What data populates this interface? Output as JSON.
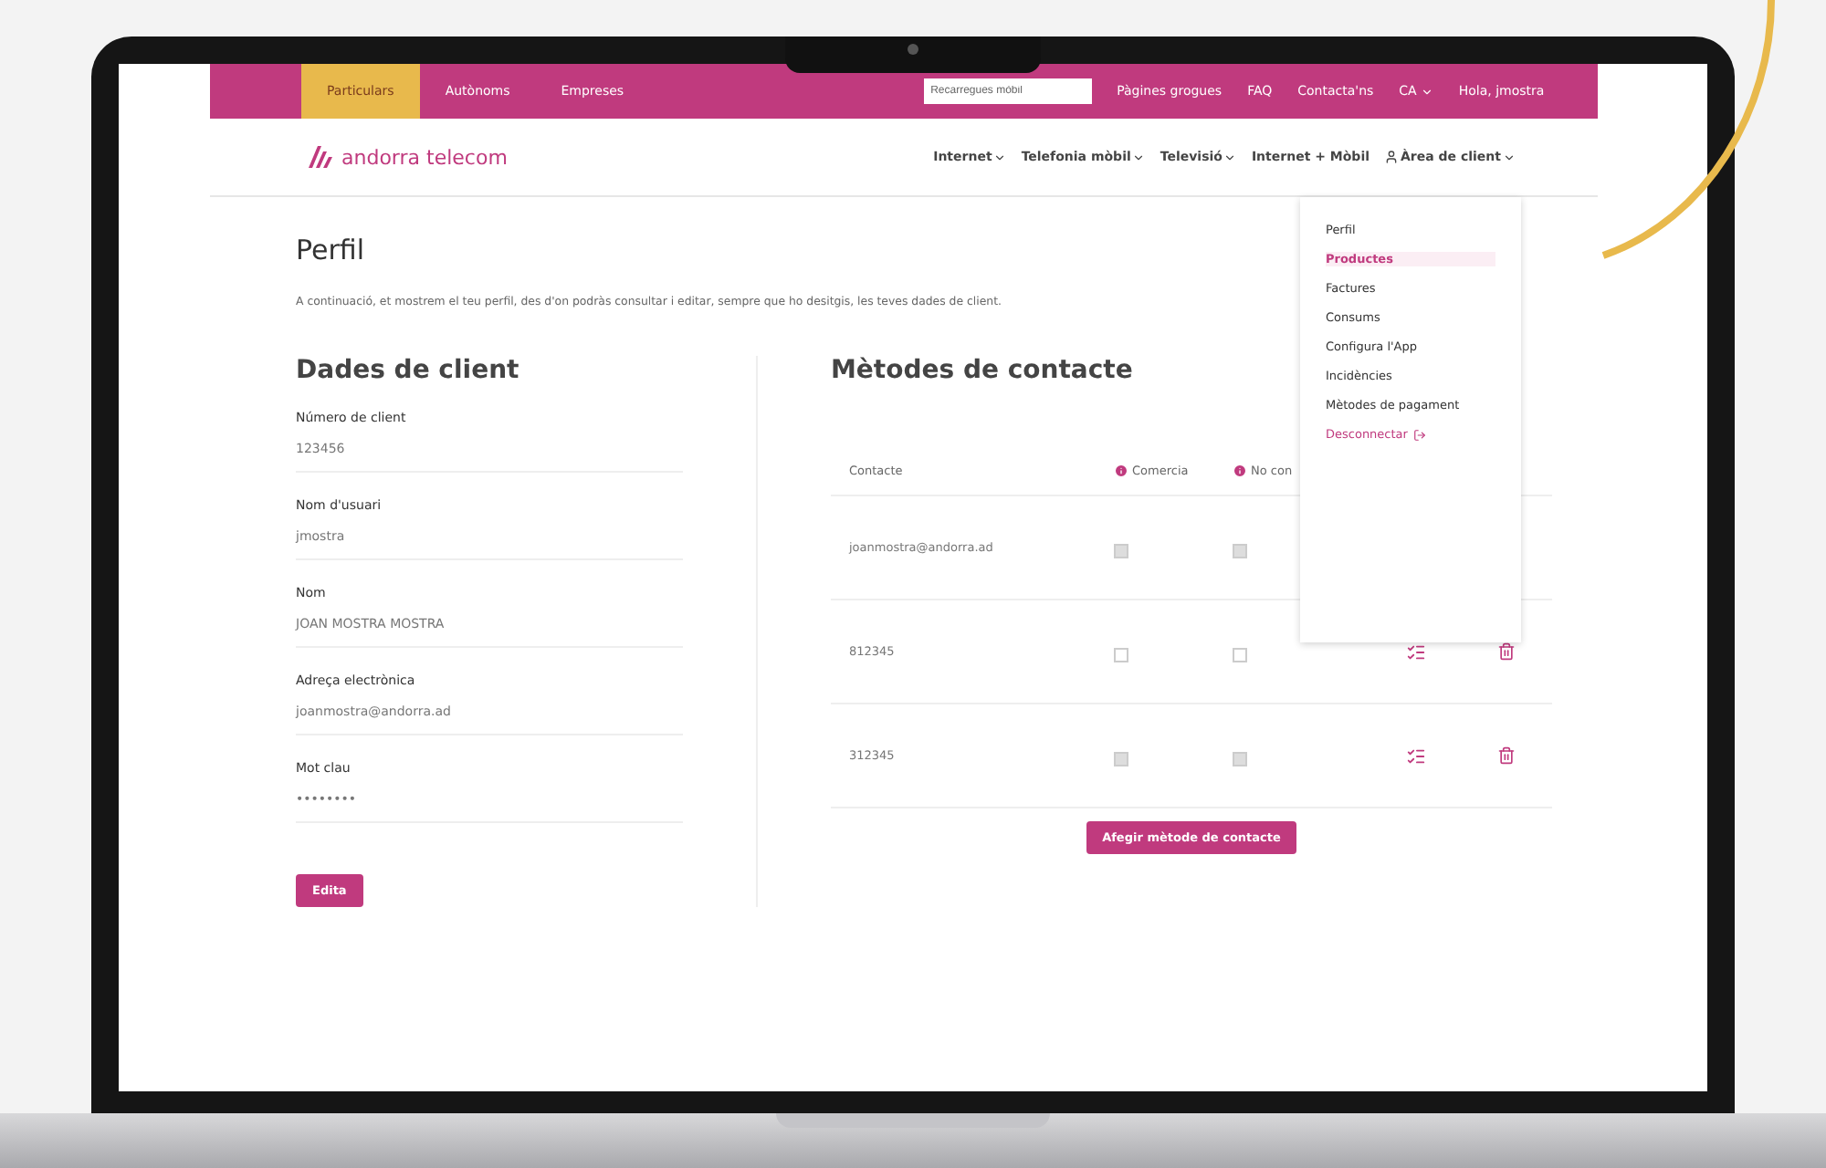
{
  "topbar": {
    "tabs": [
      {
        "label": "Particulars",
        "selected": true
      },
      {
        "label": "Autònoms",
        "selected": false
      },
      {
        "label": "Empreses",
        "selected": false
      }
    ],
    "search": {
      "placeholder": "Recarregues mòbil"
    },
    "links": [
      "Pàgines grogues",
      "FAQ",
      "Contacta'ns"
    ],
    "language": "CA",
    "greeting": "Hola, jmostra"
  },
  "brand": "andorra telecom",
  "nav": [
    {
      "label": "Internet",
      "kind": "menu"
    },
    {
      "label": "Telefonia mòbil",
      "kind": "menu"
    },
    {
      "label": "Televisió",
      "kind": "menu"
    },
    {
      "label": "Internet + Mòbil",
      "kind": "link"
    },
    {
      "label": "Àrea de client",
      "kind": "account"
    }
  ],
  "user_menu": {
    "items": [
      {
        "label": "Perfil",
        "selected": false,
        "kind": "item"
      },
      {
        "label": "Productes",
        "selected": true,
        "kind": "item"
      },
      {
        "label": "Factures",
        "selected": false,
        "kind": "item"
      },
      {
        "label": "Consums",
        "selected": false,
        "kind": "item"
      },
      {
        "label": "Configura l'App",
        "selected": false,
        "kind": "item"
      },
      {
        "label": "Incidències",
        "selected": false,
        "kind": "item"
      },
      {
        "label": "Mètodes de pagament",
        "selected": false,
        "kind": "item"
      },
      {
        "label": "Desconnectar",
        "selected": false,
        "kind": "logout"
      }
    ]
  },
  "page": {
    "title": "Perfil",
    "intro": "A continuació, et mostrem el teu perfil, des d'on podràs consultar i editar, sempre que ho desitgis, les teves dades de client."
  },
  "client_data": {
    "title": "Dades de client",
    "fields": [
      {
        "label": "Número de client",
        "value": "123456"
      },
      {
        "label": "Nom d'usuari",
        "value": "jmostra"
      },
      {
        "label": "Nom",
        "value": "JOAN MOSTRA MOSTRA"
      },
      {
        "label": "Adreça electrònica",
        "value": "joanmostra@andorra.ad"
      },
      {
        "label": "Mot clau",
        "value": "••••••••"
      }
    ],
    "button": "Edita"
  },
  "contacts": {
    "title": "Mètodes de contacte",
    "columns": [
      "Contacte",
      "Comercia",
      "No con"
    ],
    "rows": [
      {
        "contact": "joanmostra@andorra.ad",
        "actions": false,
        "checkboxes": [
          {
            "checked": false,
            "disabled": true
          },
          {
            "checked": false,
            "disabled": true
          }
        ]
      },
      {
        "contact": "812345",
        "actions": true,
        "checkboxes": [
          {
            "checked": false,
            "disabled": false
          },
          {
            "checked": false,
            "disabled": false
          }
        ]
      },
      {
        "contact": "312345",
        "actions": true,
        "checkboxes": [
          {
            "checked": false,
            "disabled": true
          },
          {
            "checked": false,
            "disabled": true
          }
        ]
      }
    ],
    "button": "Afegir mètode de contacte"
  }
}
